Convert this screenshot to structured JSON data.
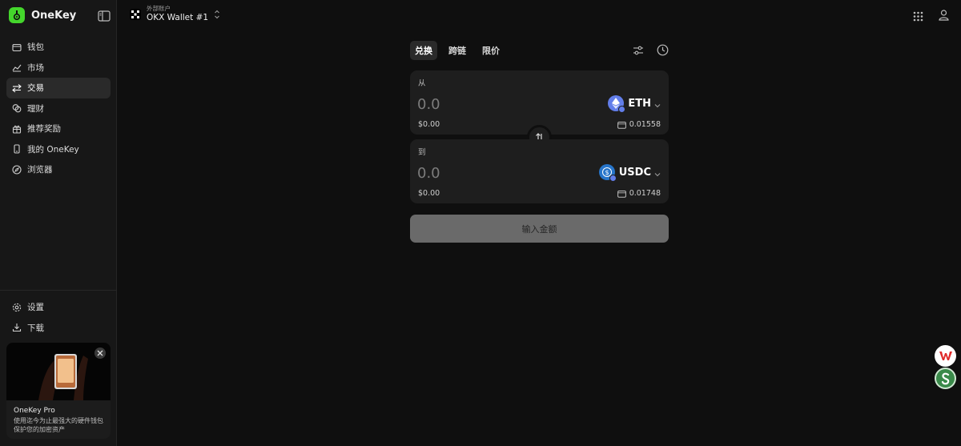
{
  "brand": {
    "name": "OneKey",
    "accent": "#44d62c"
  },
  "sidebar": {
    "items": [
      {
        "label": "钱包",
        "icon": "wallet-icon",
        "active": false
      },
      {
        "label": "市场",
        "icon": "chart-icon",
        "active": false
      },
      {
        "label": "交易",
        "icon": "swap-arrows-icon",
        "active": true
      },
      {
        "label": "理财",
        "icon": "coins-icon",
        "active": false
      },
      {
        "label": "推荐奖励",
        "icon": "gift-icon",
        "active": false
      },
      {
        "label": "我的 OneKey",
        "icon": "device-icon",
        "active": false
      },
      {
        "label": "浏览器",
        "icon": "compass-icon",
        "active": false
      }
    ],
    "bottom_items": [
      {
        "label": "设置",
        "icon": "gear-icon"
      },
      {
        "label": "下载",
        "icon": "download-icon"
      }
    ],
    "promo": {
      "title": "OneKey Pro",
      "description": "使用迄今为止最强大的硬件钱包保护您的加密资产"
    }
  },
  "header": {
    "account_type": "外部账户",
    "account_name": "OKX Wallet #1"
  },
  "swap": {
    "tabs": [
      {
        "label": "兑换",
        "active": true
      },
      {
        "label": "跨链",
        "active": false
      },
      {
        "label": "限价",
        "active": false
      }
    ],
    "from": {
      "label": "从",
      "amount": "0.0",
      "usd": "$0.00",
      "token": "ETH",
      "balance": "0.01558"
    },
    "to": {
      "label": "到",
      "amount": "0.0",
      "usd": "$0.00",
      "token": "USDC",
      "balance": "0.01748"
    },
    "cta_label": "输入金额"
  }
}
